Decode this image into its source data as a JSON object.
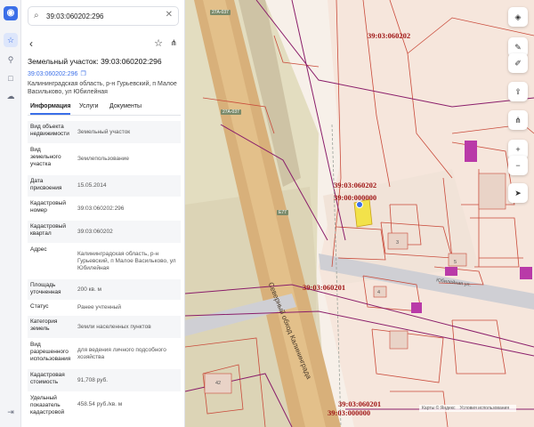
{
  "app": {
    "logo_icon": "app-logo-icon",
    "accent": "#3b6fe8"
  },
  "rail": {
    "items": [
      {
        "icon": "star-icon",
        "glyph": "☆"
      },
      {
        "icon": "pin-icon",
        "glyph": "⚲"
      },
      {
        "icon": "square-icon",
        "glyph": "□"
      },
      {
        "icon": "cloud-icon",
        "glyph": "☁"
      }
    ],
    "exit_glyph": "⇥"
  },
  "search": {
    "value": "39:03:060202:296"
  },
  "object": {
    "title": "Земельный участок: 39:03:060202:296",
    "cadastral_link": "39:03:060202:296",
    "address": "Калининградская область, р-н Гурьевский, п Малое Васильково, ул Юбилейная"
  },
  "tabs": [
    {
      "label": "Информация",
      "active": true
    },
    {
      "label": "Услуги",
      "active": false
    },
    {
      "label": "Документы",
      "active": false
    }
  ],
  "info_rows": [
    {
      "key": "Вид объекта недвижимости",
      "value": "Земельный участок"
    },
    {
      "key": "Вид земельного участка",
      "value": "Землепользование"
    },
    {
      "key": "Дата присвоения",
      "value": "15.05.2014"
    },
    {
      "key": "Кадастровый номер",
      "value": "39:03:060202:296"
    },
    {
      "key": "Кадастровый квартал",
      "value": "39:03:060202"
    },
    {
      "key": "Адрес",
      "value": "Калининградская область, р-н Гурьевский, п Малое Васильково, ул Юбилейная"
    },
    {
      "key": "Площадь уточненная",
      "value": "200 кв. м"
    },
    {
      "key": "Статус",
      "value": "Ранее учтенный"
    },
    {
      "key": "Категория земель",
      "value": "Земли населенных пунктов"
    },
    {
      "key": "Вид разрешенного использования",
      "value": "для ведения личного подсобного хозяйства"
    },
    {
      "key": "Кадастровая стоимость",
      "value": "91,708 руб."
    },
    {
      "key": "Удельный показатель кадастровой",
      "value": "458.54 руб./кв. м"
    }
  ],
  "map": {
    "labels": {
      "l1": "39:03:060202",
      "l2": "39:03:060202",
      "l3": "39:00:000000",
      "l4": "39:03:060201",
      "l5": "39:03:060201",
      "l6": "39:03:000000"
    },
    "road_name": "Северный обход Калининграда",
    "street_name": "Юбилейная ул.",
    "road_shields": [
      "27А-037",
      "27А-037",
      "Е77"
    ],
    "houses": [
      "3",
      "5",
      "4",
      "42"
    ],
    "controls": [
      {
        "icon": "layers-icon",
        "glyph": "◈"
      },
      {
        "icon": "ruler-icon",
        "glyph": "✎"
      },
      {
        "icon": "edit-icon",
        "glyph": "✐"
      },
      {
        "icon": "upload-icon",
        "glyph": "⇪"
      },
      {
        "icon": "share-icon",
        "glyph": "⋔"
      },
      {
        "icon": "zoom-in-icon",
        "glyph": "+"
      },
      {
        "icon": "zoom-out-icon",
        "glyph": "−"
      },
      {
        "icon": "locate-icon",
        "glyph": "➤"
      }
    ],
    "credits": [
      "Карты © Яндекс",
      "Условия использования"
    ]
  },
  "colors": {
    "parcel": "#c94a3a",
    "boundary": "#8a1d6a",
    "road": "#d8b07a",
    "building": "#b93aa8",
    "highlight": "#f2e24a"
  }
}
